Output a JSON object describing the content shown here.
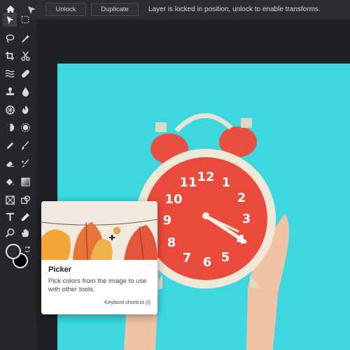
{
  "topbar": {
    "home_icon": "home-icon",
    "pointer_icon": "pointer-icon",
    "unlock_label": "Unlock",
    "duplicate_label": "Duplicate",
    "status_text": "Layer is locked in position, unlock to enable transforms."
  },
  "toolbar": {
    "tools": [
      {
        "name": "move-tool-icon",
        "active": true
      },
      {
        "name": "marquee-select-icon"
      },
      {
        "name": "lasso-icon"
      },
      {
        "name": "magic-wand-icon"
      },
      {
        "name": "crop-icon"
      },
      {
        "name": "cut-icon"
      },
      {
        "name": "liquify-icon"
      },
      {
        "name": "bandage-heal-icon"
      },
      {
        "name": "clone-stamp-icon"
      },
      {
        "name": "blur-drop-icon"
      },
      {
        "name": "sponge-icon"
      },
      {
        "name": "burn-icon"
      },
      {
        "name": "dodge-icon"
      },
      {
        "name": "sharpen-icon"
      },
      {
        "name": "pencil-icon"
      },
      {
        "name": "brush-icon"
      },
      {
        "name": "eraser-icon"
      },
      {
        "name": "color-replace-icon"
      },
      {
        "name": "paint-bucket-icon"
      },
      {
        "name": "gradient-icon"
      },
      {
        "name": "placeholder-icon"
      },
      {
        "name": "shape-icon"
      },
      {
        "name": "text-icon"
      },
      {
        "name": "eyedropper-picker-icon",
        "active": true
      },
      {
        "name": "zoom-icon"
      },
      {
        "name": "hand-icon"
      }
    ],
    "foreground_color": "#2a2b2f",
    "background_color": "#000000"
  },
  "canvas": {
    "background_color": "#3dd8df",
    "clock_face_color": "#ea4a3b",
    "clock_numbers": [
      "12",
      "1",
      "2",
      "3",
      "4",
      "5",
      "6",
      "7",
      "8",
      "9",
      "10",
      "11"
    ]
  },
  "tooltip": {
    "title": "Picker",
    "description": "Pick colors from the image to use with other tools.",
    "shortcut": "Keybord shortcut (I)"
  }
}
